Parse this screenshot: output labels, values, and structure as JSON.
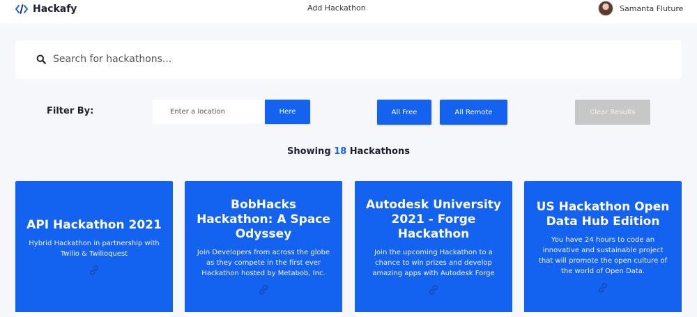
{
  "header": {
    "logo_text": "Hackafy",
    "logo_icon": "code-icon",
    "nav_add": "Add Hackathon",
    "user_name": "Samanta Fluture"
  },
  "search": {
    "placeholder": "Search for hackathons...",
    "value": ""
  },
  "filter": {
    "label": "Filter By:",
    "location_placeholder": "Enter a location",
    "here_label": "Here",
    "all_free_label": "All Free",
    "all_remote_label": "All Remote",
    "clear_label": "Clear Results"
  },
  "results": {
    "prefix": "Showing ",
    "count": "18",
    "suffix": " Hackathons"
  },
  "cards": [
    {
      "title": "API Hackathon 2021",
      "description": "Hybrid Hackathon in partnership with Twilio & Twilioquest"
    },
    {
      "title": "BobHacks Hackathon: A Space Odyssey",
      "description": "Join Developers from across the globe as they compete in the first ever Hackathon hosted by Metabob, Inc."
    },
    {
      "title": "Autodesk University 2021 - Forge Hackathon",
      "description": "Join the upcoming Hackathon to a chance to win prizes and develop amazing apps with Autodesk Forge"
    },
    {
      "title": "US Hackathon Open Data Hub Edition",
      "description": "You have 24 hours to code an innovative and sustainable project that will promote the open culture of the world of Open Data."
    }
  ],
  "colors": {
    "accent": "#1462f0",
    "background": "#f6f7fb",
    "disabled": "#c7c7c7"
  }
}
